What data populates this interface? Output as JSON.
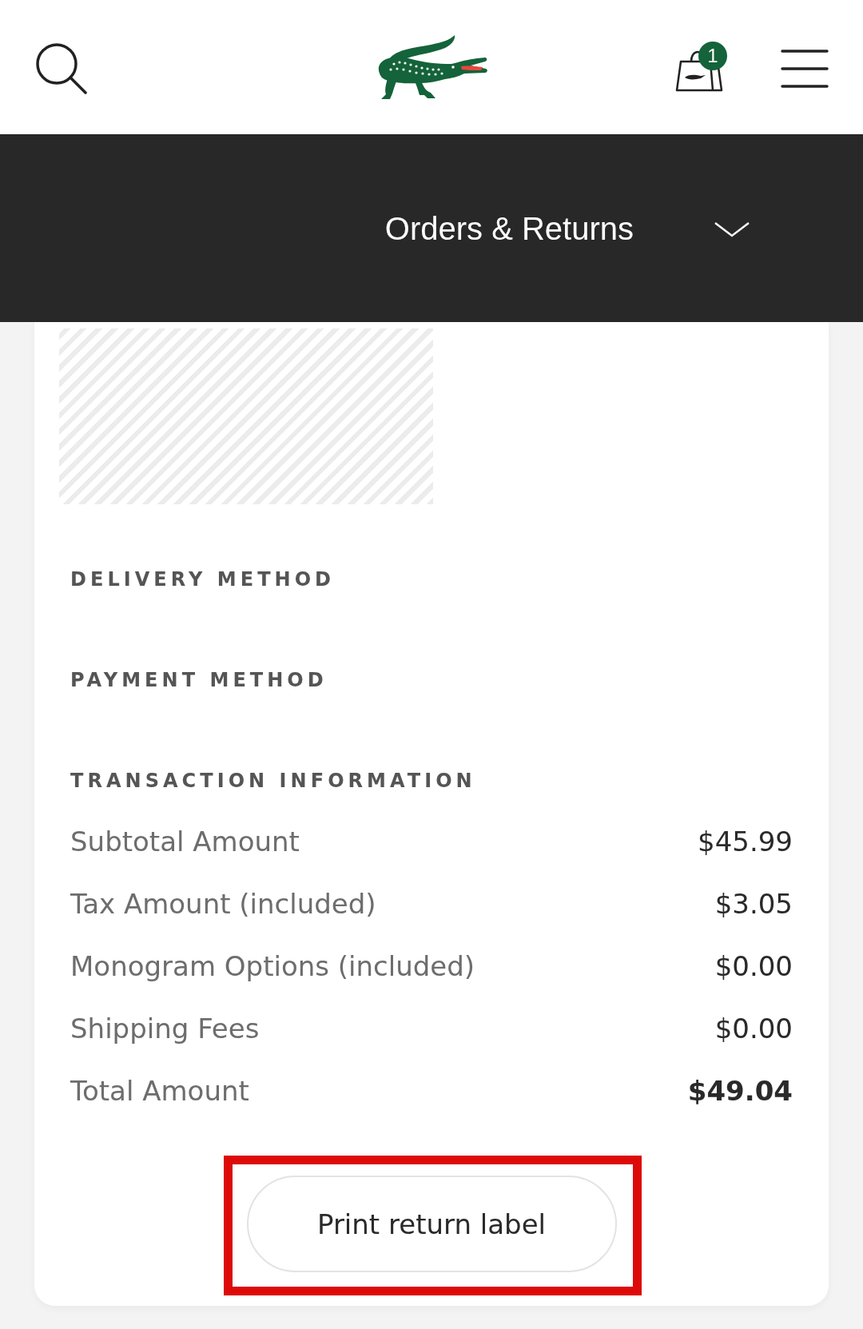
{
  "header": {
    "cart_count": "1"
  },
  "nav": {
    "title": "Orders & Returns",
    "expanded": false
  },
  "delivery_method": {
    "heading": "DELIVERY METHOD"
  },
  "payment_method": {
    "heading": "PAYMENT METHOD"
  },
  "transaction": {
    "heading": "TRANSACTION INFORMATION",
    "rows": [
      {
        "label": "Subtotal Amount",
        "value": "$45.99",
        "kind": "line"
      },
      {
        "label": "Tax Amount (included)",
        "value": "$3.05",
        "kind": "line"
      },
      {
        "label": "Monogram Options (included)",
        "value": "$0.00",
        "kind": "line"
      },
      {
        "label": "Shipping Fees",
        "value": "$0.00",
        "kind": "line"
      },
      {
        "label": "Total Amount",
        "value": "$49.04",
        "kind": "total"
      }
    ]
  },
  "print_button": {
    "label": "Print return label",
    "highlighted": true
  }
}
